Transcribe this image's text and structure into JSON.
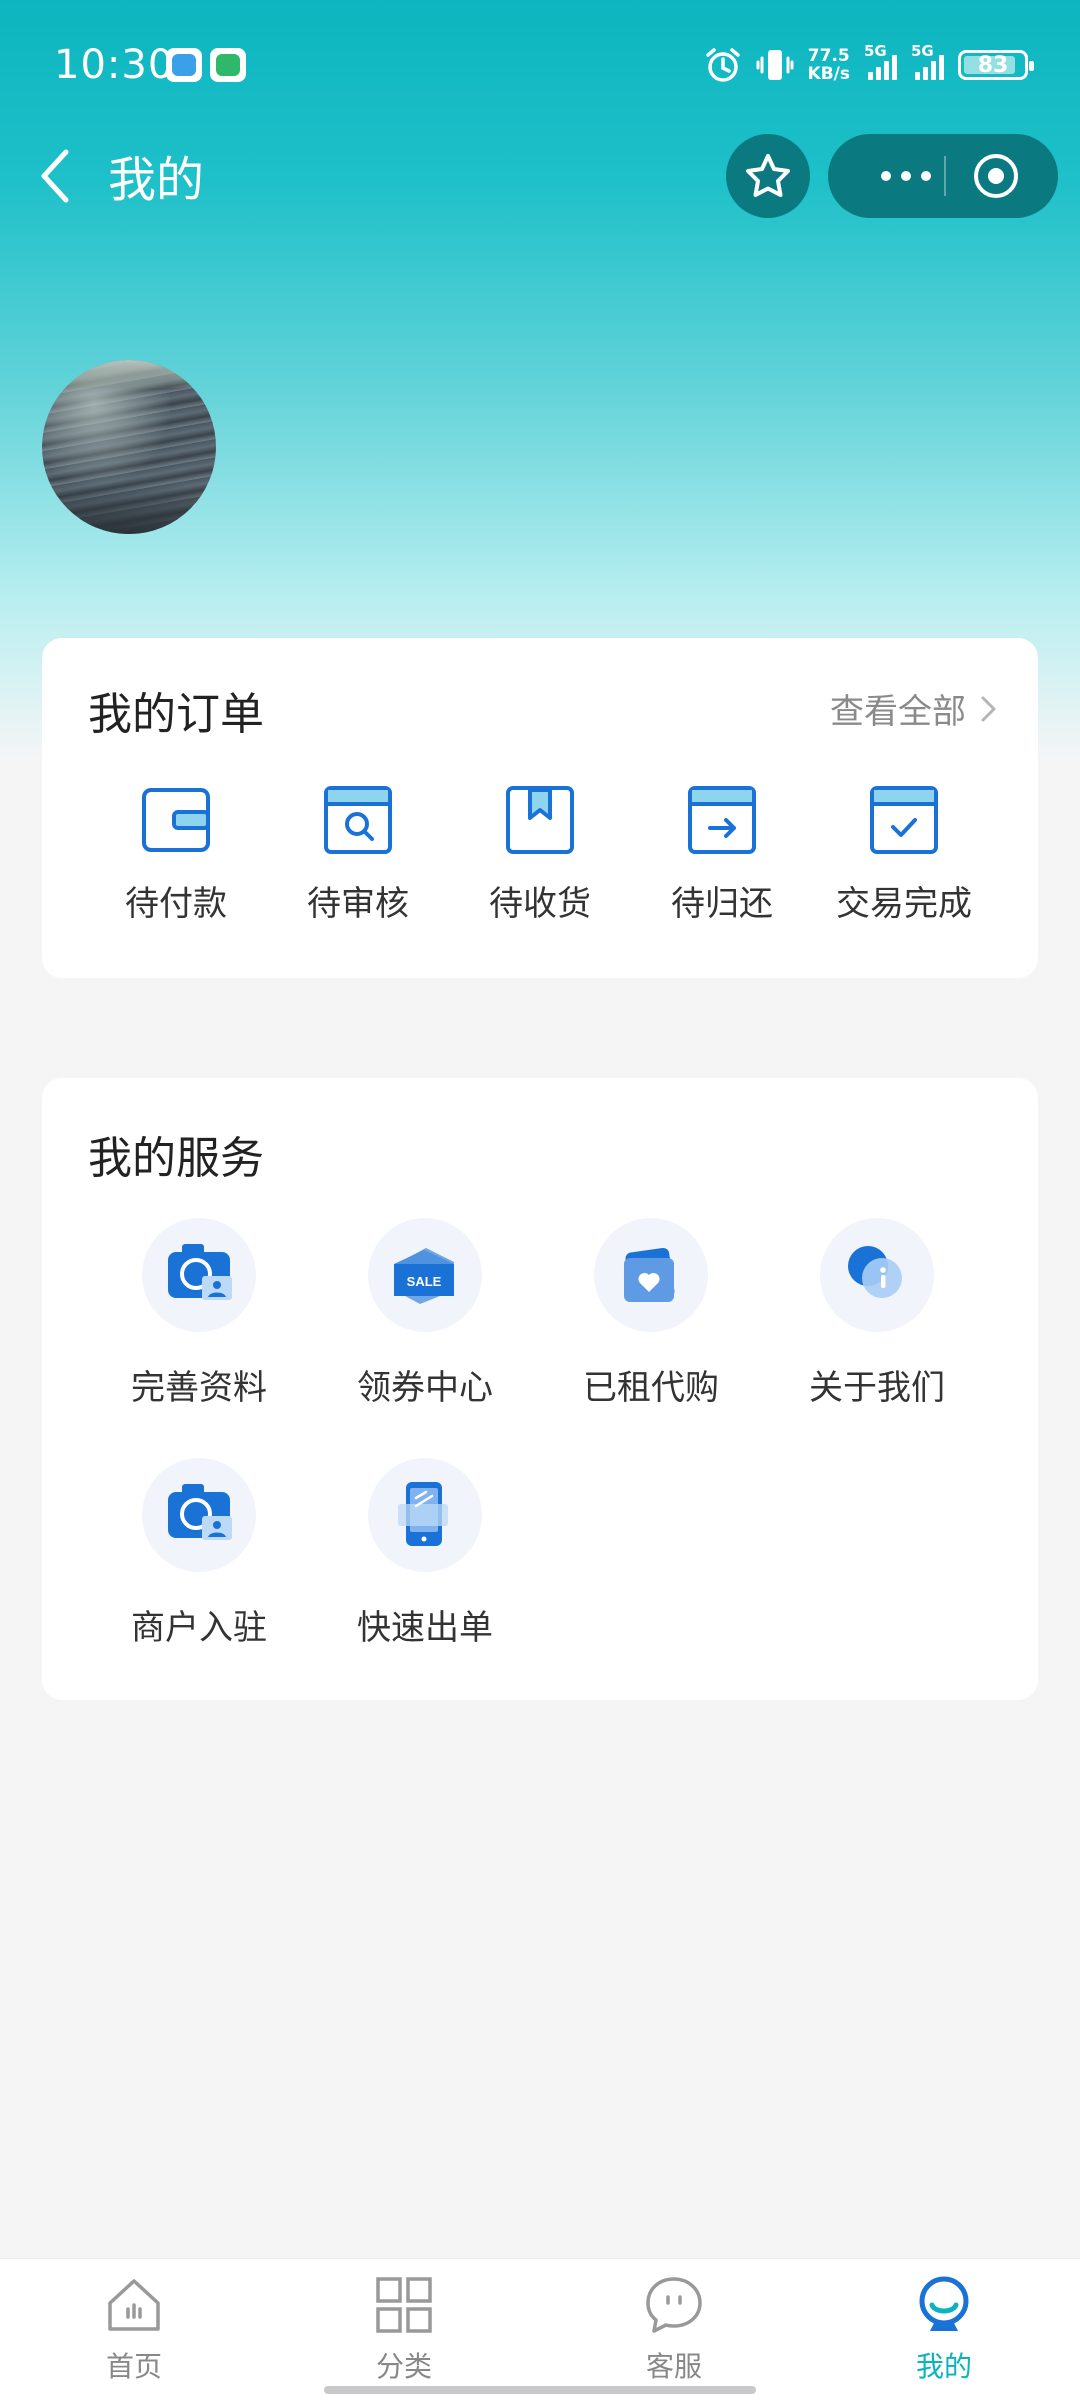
{
  "status_bar": {
    "time": "10:30",
    "net_speed_value": "77.5",
    "net_speed_unit": "KB/s",
    "signal1_label": "5G",
    "signal2_label": "5G",
    "battery": "83",
    "notification_apps": [
      "chat-app-icon",
      "home-app-icon"
    ]
  },
  "nav": {
    "title": "我的"
  },
  "orders": {
    "title": "我的订单",
    "view_all": "查看全部",
    "items": [
      {
        "label": "待付款",
        "icon": "wallet-icon"
      },
      {
        "label": "待审核",
        "icon": "review-search-icon"
      },
      {
        "label": "待收货",
        "icon": "package-icon"
      },
      {
        "label": "待归还",
        "icon": "return-arrow-icon"
      },
      {
        "label": "交易完成",
        "icon": "check-done-icon"
      }
    ]
  },
  "services": {
    "title": "我的服务",
    "items": [
      {
        "label": "完善资料",
        "icon": "camera-profile-icon"
      },
      {
        "label": "领券中心",
        "icon": "sale-coupon-icon"
      },
      {
        "label": "已租代购",
        "icon": "heart-bag-icon"
      },
      {
        "label": "关于我们",
        "icon": "info-icon"
      },
      {
        "label": "商户入驻",
        "icon": "camera-merchant-icon"
      },
      {
        "label": "快速出单",
        "icon": "phone-order-icon"
      }
    ]
  },
  "tabbar": {
    "items": [
      {
        "label": "首页",
        "icon": "home-icon"
      },
      {
        "label": "分类",
        "icon": "grid-icon"
      },
      {
        "label": "客服",
        "icon": "chat-bubble-icon"
      },
      {
        "label": "我的",
        "icon": "profile-icon",
        "active": true
      }
    ]
  },
  "colors": {
    "accent": "#0ab3bd",
    "icon_blue": "#1a72d6",
    "nav_button": "#0b7a80"
  }
}
